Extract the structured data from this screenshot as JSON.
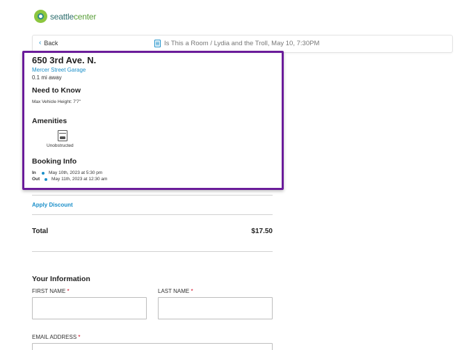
{
  "brand": {
    "logo_text_a": "seattle",
    "logo_text_b": "center"
  },
  "topbar": {
    "back_label": "Back",
    "event_title": "Is This a Room / Lydia and the Troll, May 10, 7:30PM"
  },
  "location": {
    "address": "650 3rd Ave. N.",
    "garage": "Mercer Street Garage",
    "distance": "0.1 mi away"
  },
  "need_to_know": {
    "heading": "Need to Know",
    "text": "Max Vehicle Height: 7'7\""
  },
  "amenities": {
    "heading": "Amenities",
    "items": [
      {
        "label": "Unobstructed",
        "icon": "parking-car-icon"
      }
    ]
  },
  "booking": {
    "heading": "Booking Info",
    "in_label": "In",
    "in_value": "May 10th, 2023 at 5:30 pm",
    "out_label": "Out",
    "out_value": "May 11th, 2023 at 12:30 am"
  },
  "discount": {
    "label": "Apply Discount"
  },
  "total": {
    "label": "Total",
    "value": "$17.50"
  },
  "your_info": {
    "heading": "Your Information",
    "first_name_label": "FIRST NAME",
    "last_name_label": "LAST NAME",
    "email_label": "EMAIL ADDRESS",
    "required_marker": "*",
    "first_name_value": "",
    "last_name_value": "",
    "email_value": ""
  },
  "colors": {
    "accent": "#1a8fc9",
    "highlight": "#6a1b9a",
    "required": "#d0021b"
  }
}
